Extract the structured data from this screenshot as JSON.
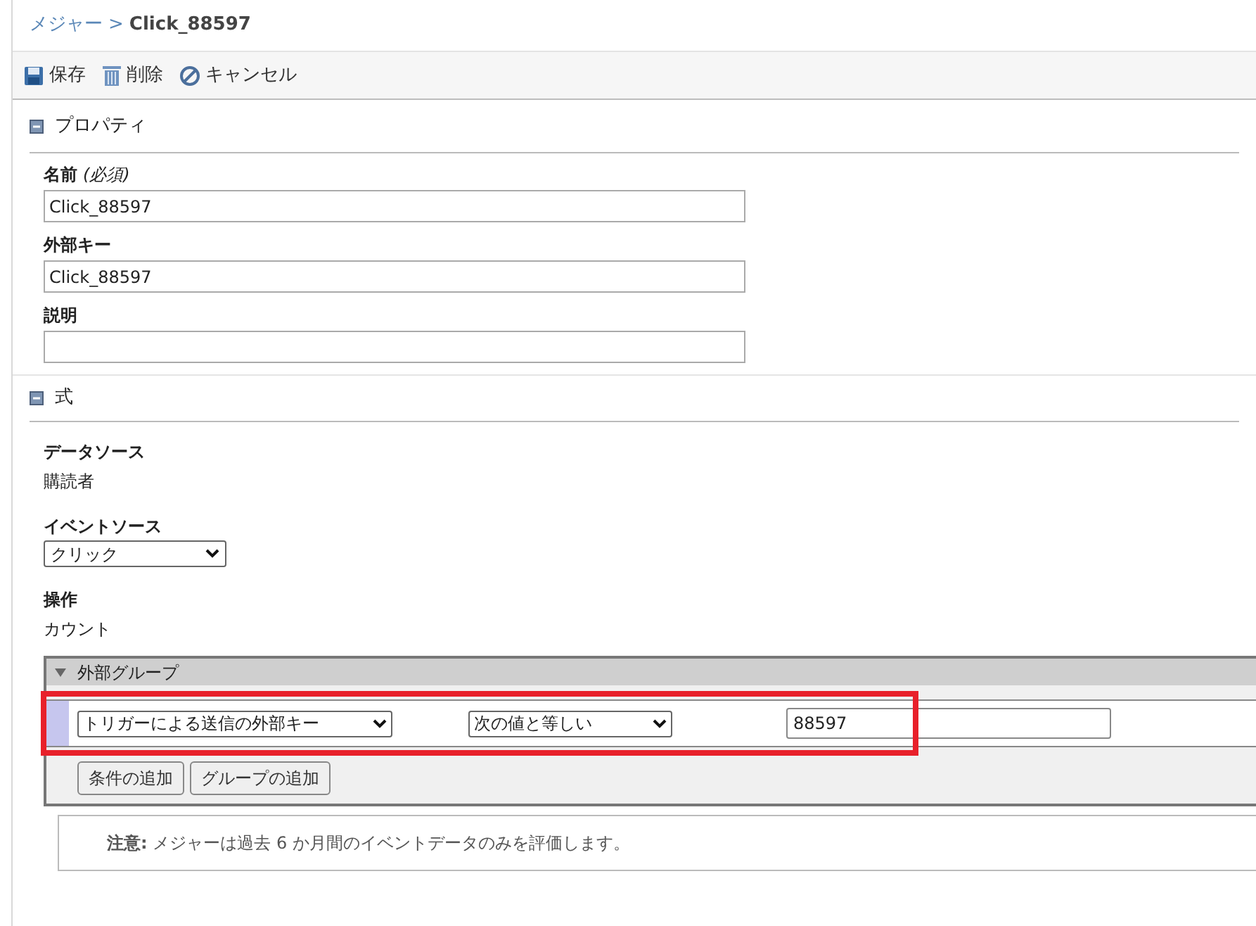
{
  "breadcrumb": {
    "parent": "メジャー",
    "separator": ">",
    "current": "Click_88597"
  },
  "toolbar": [
    {
      "kind": "save",
      "label": "保存"
    },
    {
      "kind": "delete",
      "label": "削除"
    },
    {
      "kind": "cancel",
      "label": "キャンセル"
    }
  ],
  "properties": {
    "title": "プロパティ",
    "expanded": true,
    "fields": [
      {
        "label": "名前",
        "hint": "(必須)",
        "value": "Click_88597"
      },
      {
        "label": "外部キー",
        "value": "Click_88597"
      },
      {
        "label": "説明"
      }
    ]
  },
  "formula": {
    "title": "式",
    "expanded": true,
    "data_source": {
      "label": "データソース",
      "value": "購読者"
    },
    "event_source": {
      "label": "イベントソース",
      "value": "クリック"
    },
    "operation": {
      "label": "操作",
      "value": "カウント"
    },
    "group": {
      "title": "外部グループ",
      "expanded": true,
      "conditions": [
        {
          "field": "トリガーによる送信の外部キー",
          "operator": "次の値と等しい",
          "value": "88597"
        }
      ],
      "buttons": [
        "条件の追加",
        "グループの追加"
      ]
    },
    "note": "**注意:** メジャーは過去 6 か月間のイベントデータのみを評価します。"
  }
}
